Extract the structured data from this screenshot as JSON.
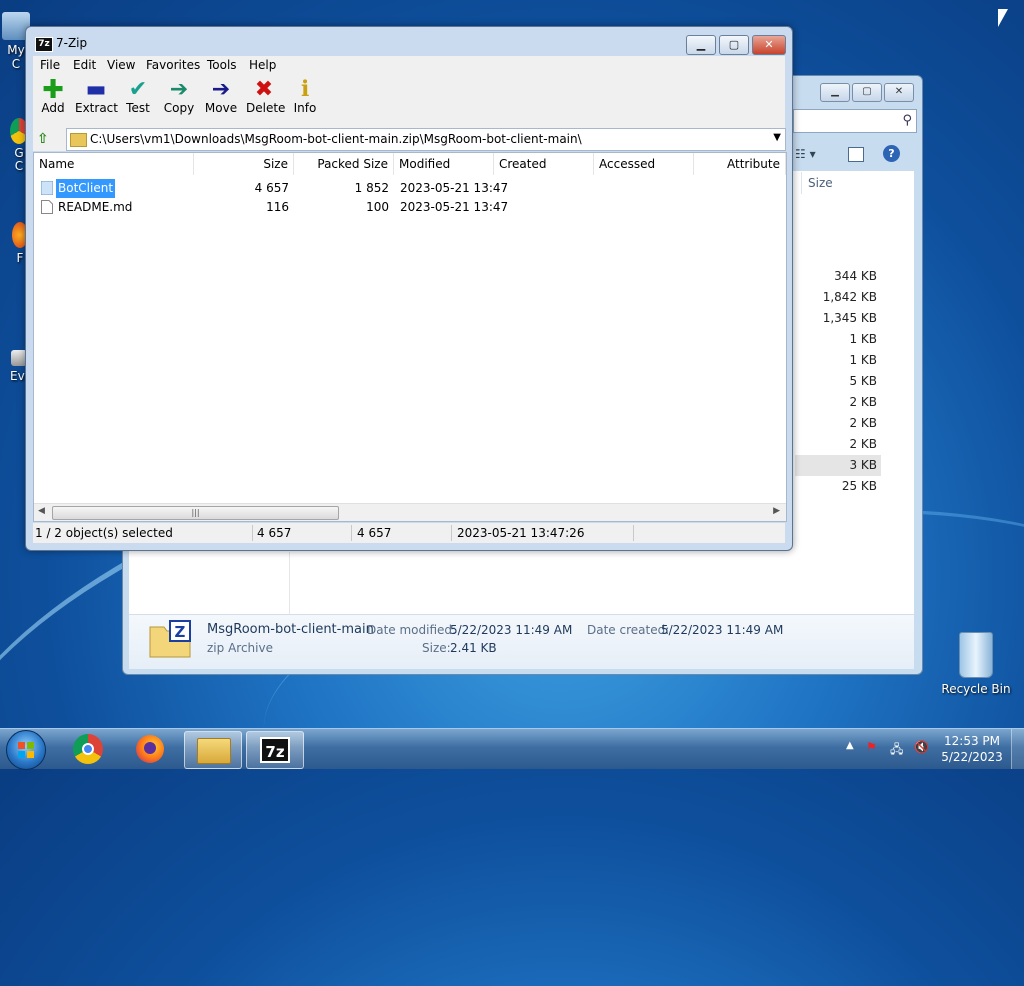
{
  "desktop": {
    "icons": [
      {
        "label": "My C"
      },
      {
        "label": "G\nC"
      },
      {
        "label": "F"
      },
      {
        "label": "Eve"
      }
    ],
    "recycle_bin": "Recycle Bin"
  },
  "explorer": {
    "col_size": "Size",
    "sizes": [
      "344 KB",
      "1,842 KB",
      "1,345 KB",
      "1 KB",
      "1 KB",
      "5 KB",
      "2 KB",
      "2 KB",
      "2 KB",
      "3 KB",
      "25 KB"
    ],
    "details": {
      "name": "MsgRoom-bot-client-main",
      "type": "zip Archive",
      "date_modified_label": "Date modified:",
      "date_modified": "5/22/2023 11:49 AM",
      "date_created_label": "Date created:",
      "date_created": "5/22/2023 11:49 AM",
      "size_label": "Size:",
      "size": "2.41 KB"
    }
  },
  "zip": {
    "title": "7-Zip",
    "menu": [
      "File",
      "Edit",
      "View",
      "Favorites",
      "Tools",
      "Help"
    ],
    "toolbar": [
      {
        "label": "Add",
        "icon": "add-icon",
        "color": "#1a9e1a",
        "glyph": "✚"
      },
      {
        "label": "Extract",
        "icon": "extract-icon",
        "color": "#1f2fa8",
        "glyph": "▬"
      },
      {
        "label": "Test",
        "icon": "test-icon",
        "color": "#19a08f",
        "glyph": "✔"
      },
      {
        "label": "Copy",
        "icon": "copy-icon",
        "color": "#1a8a6a",
        "glyph": "➔"
      },
      {
        "label": "Move",
        "icon": "move-icon",
        "color": "#1a1a8a",
        "glyph": "➔"
      },
      {
        "label": "Delete",
        "icon": "delete-icon",
        "color": "#d01010",
        "glyph": "✖"
      },
      {
        "label": "Info",
        "icon": "info-icon",
        "color": "#c8a010",
        "glyph": "ℹ"
      }
    ],
    "path": "C:\\Users\\vm1\\Downloads\\MsgRoom-bot-client-main.zip\\MsgRoom-bot-client-main\\",
    "columns": [
      "Name",
      "Size",
      "Packed Size",
      "Modified",
      "Created",
      "Accessed",
      "Attribute"
    ],
    "rows": [
      {
        "name": "BotClient",
        "size": "4 657",
        "packed": "1 852",
        "modified": "2023-05-21 13:47",
        "type": "folder",
        "selected": true
      },
      {
        "name": "README.md",
        "size": "116",
        "packed": "100",
        "modified": "2023-05-21 13:47",
        "type": "file",
        "selected": false
      }
    ],
    "status": {
      "selection": "1 / 2 object(s) selected",
      "size": "4 657",
      "packed": "4 657",
      "modified": "2023-05-21 13:47:26"
    }
  },
  "taskbar": {
    "clock_time": "12:53 PM",
    "clock_date": "5/22/2023"
  }
}
